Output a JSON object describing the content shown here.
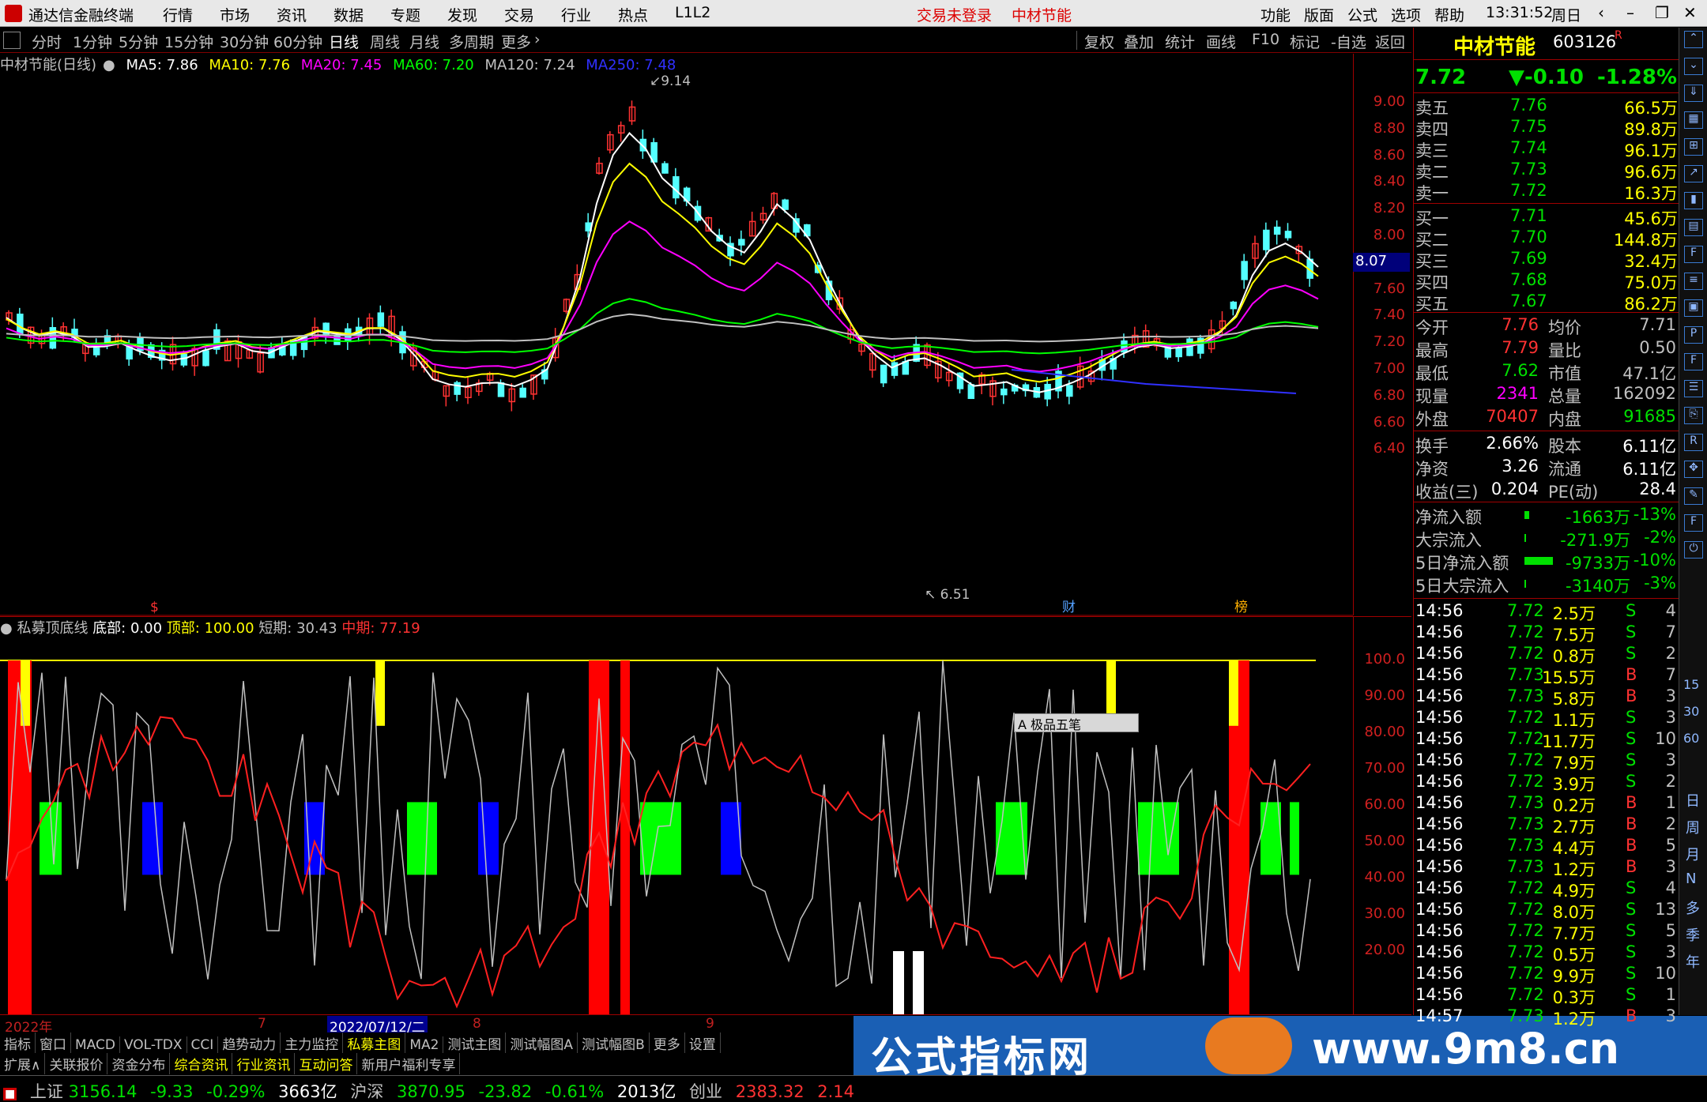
{
  "menubar": {
    "app_name": "通达信金融终端",
    "items": [
      "行情",
      "市场",
      "资讯",
      "数据",
      "专题",
      "发现",
      "交易",
      "行业",
      "热点",
      "L1L2"
    ],
    "trade_status": "交易未登录",
    "stock_name": "中材节能",
    "right_items": [
      "功能",
      "版面",
      "公式",
      "选项",
      "帮助"
    ],
    "time": "13:31:52",
    "weekday": "周日"
  },
  "periods": [
    "分时",
    "1分钟",
    "5分钟",
    "15分钟",
    "30分钟",
    "60分钟",
    "日线",
    "周线",
    "月线",
    "多周期",
    "更多"
  ],
  "active_period": "日线",
  "toolbar_right": [
    "复权",
    "叠加",
    "统计",
    "画线",
    "F10",
    "标记",
    "-自选",
    "返回"
  ],
  "main_chart": {
    "label": "中材节能(日线)",
    "ma5": "MA5: 7.86",
    "ma10": "MA10: 7.76",
    "ma20": "MA20: 7.45",
    "ma60": "MA60: 7.20",
    "ma120": "MA120: 7.24",
    "ma250": "MA250: 7.48",
    "high_mark": "9.14",
    "low_mark": "6.51",
    "current_price_box": "8.07",
    "y_ticks": [
      "9.00",
      "8.80",
      "8.60",
      "8.40",
      "8.20",
      "8.00",
      "7.80",
      "7.60",
      "7.40",
      "7.20",
      "7.00",
      "6.80",
      "6.60",
      "6.40"
    ],
    "markers": [
      "$",
      "财",
      "榜"
    ],
    "colors": {
      "up": "#ff3232",
      "down": "#54ffff",
      "ma5": "#ffffff",
      "ma10": "#ffff00",
      "ma20": "#ff00ff",
      "ma60": "#00ff00",
      "ma120": "#c0c0c0",
      "ma250": "#3030ff"
    }
  },
  "indicator": {
    "name": "私募顶底线",
    "bottom": "底部: 0.00",
    "top": "顶部: 100.00",
    "short": "短期: 30.43",
    "mid": "中期: 77.19",
    "y_ticks": [
      "100.0",
      "90.00",
      "80.00",
      "70.00",
      "60.00",
      "50.00",
      "40.00",
      "30.00",
      "20.00"
    ],
    "popup": "极品五笔"
  },
  "date_axis": [
    "2022年",
    "7",
    "2022/07/12/二",
    "8",
    "9"
  ],
  "tabs1": [
    "指标",
    "窗口",
    "MACD",
    "VOL-TDX",
    "CCI",
    "趋势动力",
    "主力监控",
    "私募主图",
    "MA2",
    "测试主图",
    "测试幅图A",
    "测试幅图B",
    "更多",
    "设置"
  ],
  "tabs1_active": "私募主图",
  "tabs2": [
    "扩展∧",
    "关联报价",
    "资金分布",
    "综合资讯",
    "行业资讯",
    "互动问答",
    "新用户福利专享"
  ],
  "status": {
    "sh_label": "上证",
    "sh_val": "3156.14",
    "sh_chg": "-9.33",
    "sh_pct": "-0.29%",
    "sh_amt": "3663亿",
    "hs_label": "沪深",
    "hs_val": "3870.95",
    "hs_chg": "-23.82",
    "hs_pct": "-0.61%",
    "hs_amt": "2013亿",
    "cy_label": "创业",
    "cy_val": "2383.32",
    "cy_chg": "2.14"
  },
  "watermark": {
    "text": "公式指标网",
    "url": "www.9m8.cn"
  },
  "quote": {
    "name": "中材节能",
    "code": "603126",
    "flag": "R",
    "price": "7.72",
    "change": "▼-0.10",
    "pct": "-1.28%",
    "asks": [
      {
        "label": "卖五",
        "price": "7.76",
        "vol": "66.5万"
      },
      {
        "label": "卖四",
        "price": "7.75",
        "vol": "89.8万"
      },
      {
        "label": "卖三",
        "price": "7.74",
        "vol": "96.1万"
      },
      {
        "label": "卖二",
        "price": "7.73",
        "vol": "96.6万"
      },
      {
        "label": "卖一",
        "price": "7.72",
        "vol": "16.3万"
      }
    ],
    "bids": [
      {
        "label": "买一",
        "price": "7.71",
        "vol": "45.6万"
      },
      {
        "label": "买二",
        "price": "7.70",
        "vol": "144.8万"
      },
      {
        "label": "买三",
        "price": "7.69",
        "vol": "32.4万"
      },
      {
        "label": "买四",
        "price": "7.68",
        "vol": "75.0万"
      },
      {
        "label": "买五",
        "price": "7.67",
        "vol": "86.2万"
      }
    ],
    "stats": [
      {
        "l1": "今开",
        "v1": "7.76",
        "c1": "#ff3232",
        "l2": "均价",
        "v2": "7.71",
        "c2": "#c0c0c0"
      },
      {
        "l1": "最高",
        "v1": "7.79",
        "c1": "#ff3232",
        "l2": "量比",
        "v2": "0.50",
        "c2": "#c0c0c0"
      },
      {
        "l1": "最低",
        "v1": "7.62",
        "c1": "#00e000",
        "l2": "市值",
        "v2": "47.1亿",
        "c2": "#c0c0c0"
      },
      {
        "l1": "现量",
        "v1": "2341",
        "c1": "#ff00ff",
        "l2": "总量",
        "v2": "162092",
        "c2": "#c0c0c0"
      },
      {
        "l1": "外盘",
        "v1": "70407",
        "c1": "#ff3232",
        "l2": "内盘",
        "v2": "91685",
        "c2": "#00e000"
      }
    ],
    "stats2": [
      {
        "l1": "换手",
        "v1": "2.66%",
        "l2": "股本",
        "v2": "6.11亿"
      },
      {
        "l1": "净资",
        "v1": "3.26",
        "l2": "流通",
        "v2": "6.11亿"
      },
      {
        "l1": "收益(三)",
        "v1": "0.204",
        "l2": "PE(动)",
        "v2": "28.4"
      }
    ],
    "flows": [
      {
        "label": "净流入额",
        "val": "-1663万",
        "pct": "-13%"
      },
      {
        "label": "大宗流入",
        "val": "-271.9万",
        "pct": "-2%"
      },
      {
        "label": "5日净流入额",
        "val": "-9733万",
        "pct": "-10%"
      },
      {
        "label": "5日大宗流入",
        "val": "-3140万",
        "pct": "-3%"
      }
    ],
    "ticks": [
      {
        "t": "14:56",
        "p": "7.72",
        "v": "2.5万",
        "d": "S",
        "n": "4"
      },
      {
        "t": "14:56",
        "p": "7.72",
        "v": "7.5万",
        "d": "S",
        "n": "7"
      },
      {
        "t": "14:56",
        "p": "7.72",
        "v": "0.8万",
        "d": "S",
        "n": "2"
      },
      {
        "t": "14:56",
        "p": "7.73",
        "v": "15.5万",
        "d": "B",
        "n": "7"
      },
      {
        "t": "14:56",
        "p": "7.73",
        "v": "5.8万",
        "d": "B",
        "n": "3"
      },
      {
        "t": "14:56",
        "p": "7.72",
        "v": "1.1万",
        "d": "S",
        "n": "3"
      },
      {
        "t": "14:56",
        "p": "7.72",
        "v": "11.7万",
        "d": "S",
        "n": "10"
      },
      {
        "t": "14:56",
        "p": "7.72",
        "v": "7.9万",
        "d": "S",
        "n": "3"
      },
      {
        "t": "14:56",
        "p": "7.72",
        "v": "3.9万",
        "d": "S",
        "n": "2"
      },
      {
        "t": "14:56",
        "p": "7.73",
        "v": "0.2万",
        "d": "B",
        "n": "1"
      },
      {
        "t": "14:56",
        "p": "7.73",
        "v": "2.7万",
        "d": "B",
        "n": "2"
      },
      {
        "t": "14:56",
        "p": "7.73",
        "v": "4.4万",
        "d": "B",
        "n": "5"
      },
      {
        "t": "14:56",
        "p": "7.73",
        "v": "1.2万",
        "d": "B",
        "n": "3"
      },
      {
        "t": "14:56",
        "p": "7.72",
        "v": "4.9万",
        "d": "S",
        "n": "4"
      },
      {
        "t": "14:56",
        "p": "7.72",
        "v": "8.0万",
        "d": "S",
        "n": "13"
      },
      {
        "t": "14:56",
        "p": "7.72",
        "v": "7.7万",
        "d": "S",
        "n": "5"
      },
      {
        "t": "14:56",
        "p": "7.72",
        "v": "0.5万",
        "d": "S",
        "n": "3"
      },
      {
        "t": "14:56",
        "p": "7.72",
        "v": "9.9万",
        "d": "S",
        "n": "10"
      },
      {
        "t": "14:56",
        "p": "7.72",
        "v": "0.3万",
        "d": "S",
        "n": "1"
      },
      {
        "t": "14:57",
        "p": "7.73",
        "v": "1.2万",
        "d": "B",
        "n": "3"
      }
    ]
  },
  "side_texts": [
    "日",
    "周",
    "月",
    "N",
    "多",
    "季",
    "年"
  ],
  "side_nums": [
    "15",
    "30",
    "60"
  ]
}
